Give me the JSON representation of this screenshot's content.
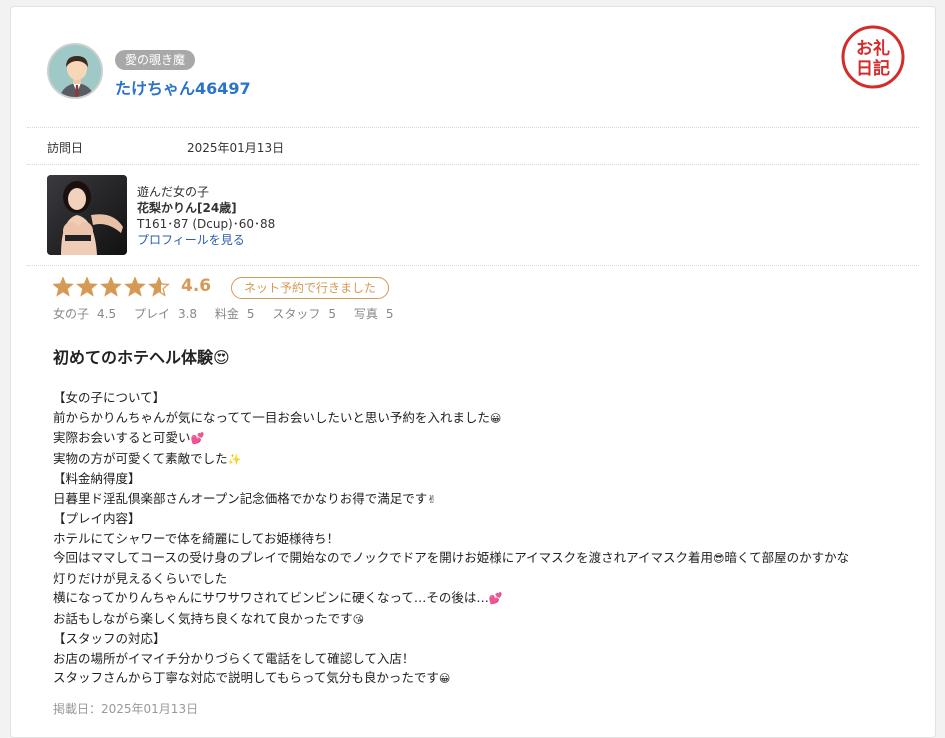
{
  "reviewer": {
    "rank_badge": "愛の覗き魔",
    "username": "たけちゃん46497"
  },
  "stamp": {
    "label": "お礼日記",
    "color": "#d42b2b"
  },
  "visit": {
    "label": "訪問日",
    "date": "2025年01月13日"
  },
  "girl": {
    "section_label": "遊んだ女の子",
    "name": "花梨かりん[24歳]",
    "measurements": "T161･87 (Dcup)･60･88",
    "profile_link": "プロフィールを見る"
  },
  "rating": {
    "stars_value": 4.6,
    "score_text": "4.6",
    "reservation_badge": "ネット予約で行きました",
    "star_color": "#d49a56",
    "subscores": [
      {
        "label": "女の子",
        "value": "4.5"
      },
      {
        "label": "プレイ",
        "value": "3.8"
      },
      {
        "label": "料金",
        "value": "5"
      },
      {
        "label": "スタッフ",
        "value": "5"
      },
      {
        "label": "写真",
        "value": "5"
      }
    ]
  },
  "review": {
    "title": "初めてのホテヘル体験",
    "title_emoji": "😍",
    "lines": [
      {
        "text": "【女の子について】",
        "emoji": ""
      },
      {
        "text": "前からかりんちゃんが気になってて一目お会いしたいと思い予約を入れました",
        "emoji": "😀"
      },
      {
        "text": "実際お会いすると可愛い",
        "emoji": "💕"
      },
      {
        "text": "実物の方が可愛くて素敵でした",
        "emoji": "✨"
      },
      {
        "text": "【料金納得度】",
        "emoji": ""
      },
      {
        "text": "日暮里ド淫乱倶楽部さんオープン記念価格でかなりお得で満足です",
        "emoji": "✌"
      },
      {
        "text": "【プレイ内容】",
        "emoji": ""
      },
      {
        "text": "ホテルにてシャワーで体を綺麗にしてお姫様待ち！",
        "emoji": ""
      },
      {
        "text": "今回はママしてコースの受け身のプレイで開始なのでノックでドアを開けお姫様にアイマスクを渡されアイマスク着用",
        "emoji": "😎",
        "after": "暗くて部屋のかすかな"
      },
      {
        "text": "灯りだけが見えるくらいでした",
        "emoji": ""
      },
      {
        "text": "横になってかりんちゃんにサワサワされてビンビンに硬くなって…その後は…",
        "emoji": "💕"
      },
      {
        "text": "お話もしながら楽しく気持ち良くなれて良かったです",
        "emoji": "😘"
      },
      {
        "text": "【スタッフの対応】",
        "emoji": ""
      },
      {
        "text": "お店の場所がイマイチ分かりづらくて電話をして確認して入店！",
        "emoji": ""
      },
      {
        "text": "スタッフさんから丁寧な対応で説明してもらって気分も良かったです",
        "emoji": "😀"
      }
    ]
  },
  "posted": "掲載日：2025年01月13日"
}
